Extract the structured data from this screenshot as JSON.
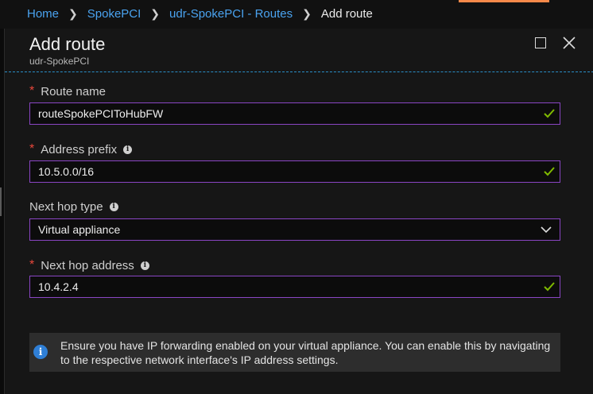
{
  "breadcrumb": {
    "items": [
      "Home",
      "SpokePCI",
      "udr-SpokePCI - Routes"
    ],
    "current": "Add route"
  },
  "blade": {
    "title": "Add route",
    "subtitle": "udr-SpokePCI"
  },
  "form": {
    "route_name": {
      "label": "Route name",
      "value": "routeSpokePCIToHubFW",
      "required": true
    },
    "address_prefix": {
      "label": "Address prefix",
      "value": "10.5.0.0/16",
      "required": true
    },
    "next_hop_type": {
      "label": "Next hop type",
      "value": "Virtual appliance",
      "required": false
    },
    "next_hop_address": {
      "label": "Next hop address",
      "value": "10.4.2.4",
      "required": true
    }
  },
  "info_message": "Ensure you have IP forwarding enabled on your virtual appliance. You can enable this by navigating to the respective network interface's IP address settings.",
  "colors": {
    "accent_link": "#4aa3f0",
    "input_border": "#8a45c4",
    "valid_check": "#7fba00",
    "required_star": "#e8473b",
    "info_icon": "#2f7fd6"
  }
}
